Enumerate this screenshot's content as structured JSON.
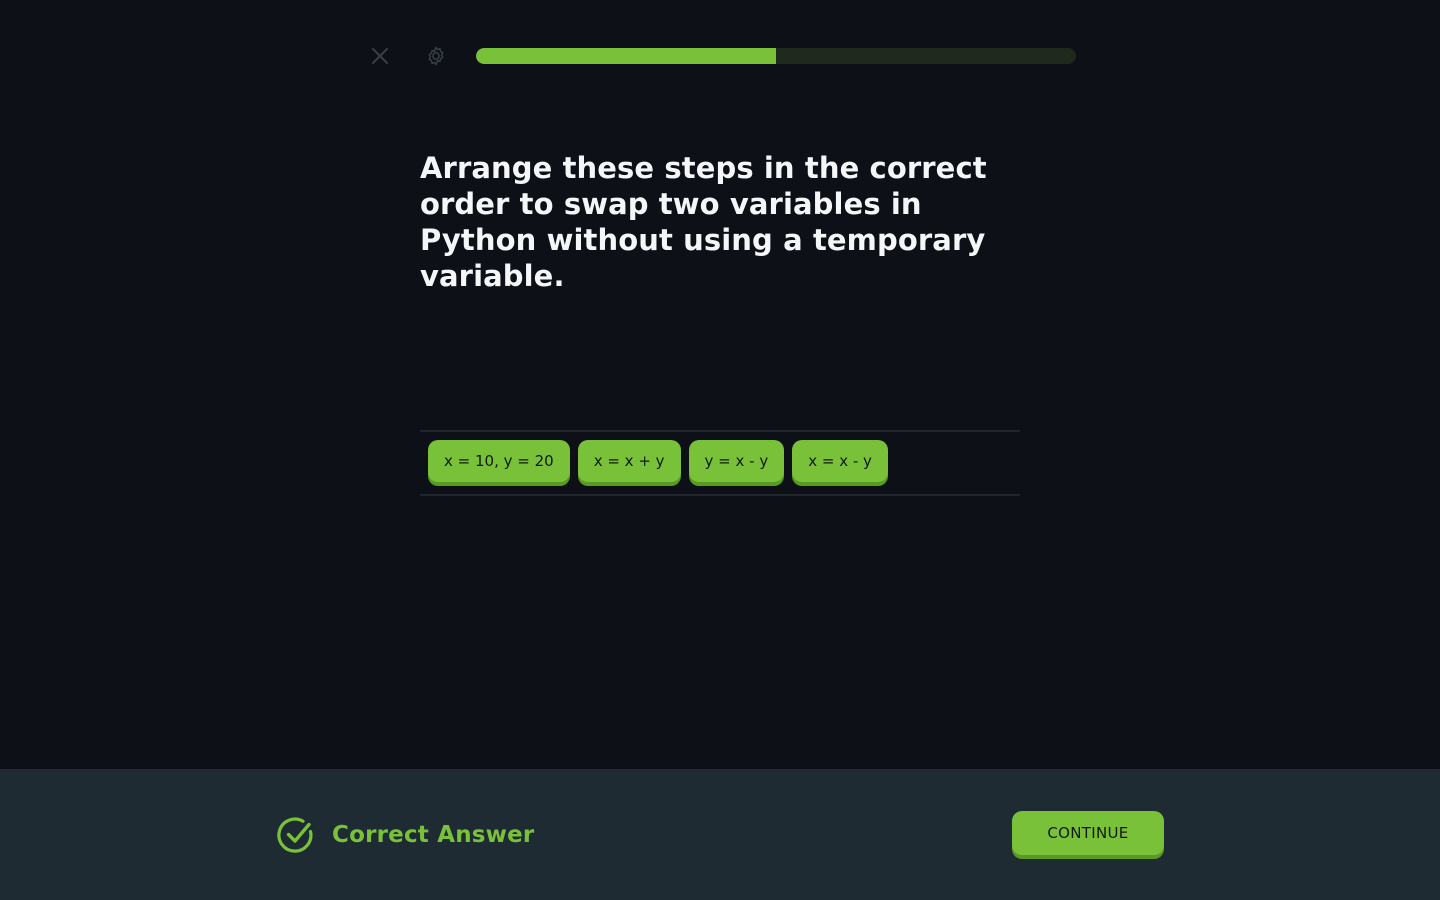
{
  "colors": {
    "background": "#0d1017",
    "accent": "#7ac13a",
    "footer_bg": "#1e2b33",
    "progress_track": "#1f2a1c"
  },
  "topbar": {
    "close_icon": "close-icon",
    "settings_icon": "gear-icon",
    "progress_fraction": 0.5
  },
  "question": {
    "text": "Arrange these steps in the correct order to swap two variables in Python without using a temporary variable."
  },
  "answer": {
    "chips": [
      "x = 10, y = 20",
      "x = x + y",
      "y = x - y",
      "x = x - y"
    ]
  },
  "footer": {
    "status_icon": "check-circle-icon",
    "status_text": "Correct Answer",
    "continue_label": "CONTINUE"
  }
}
